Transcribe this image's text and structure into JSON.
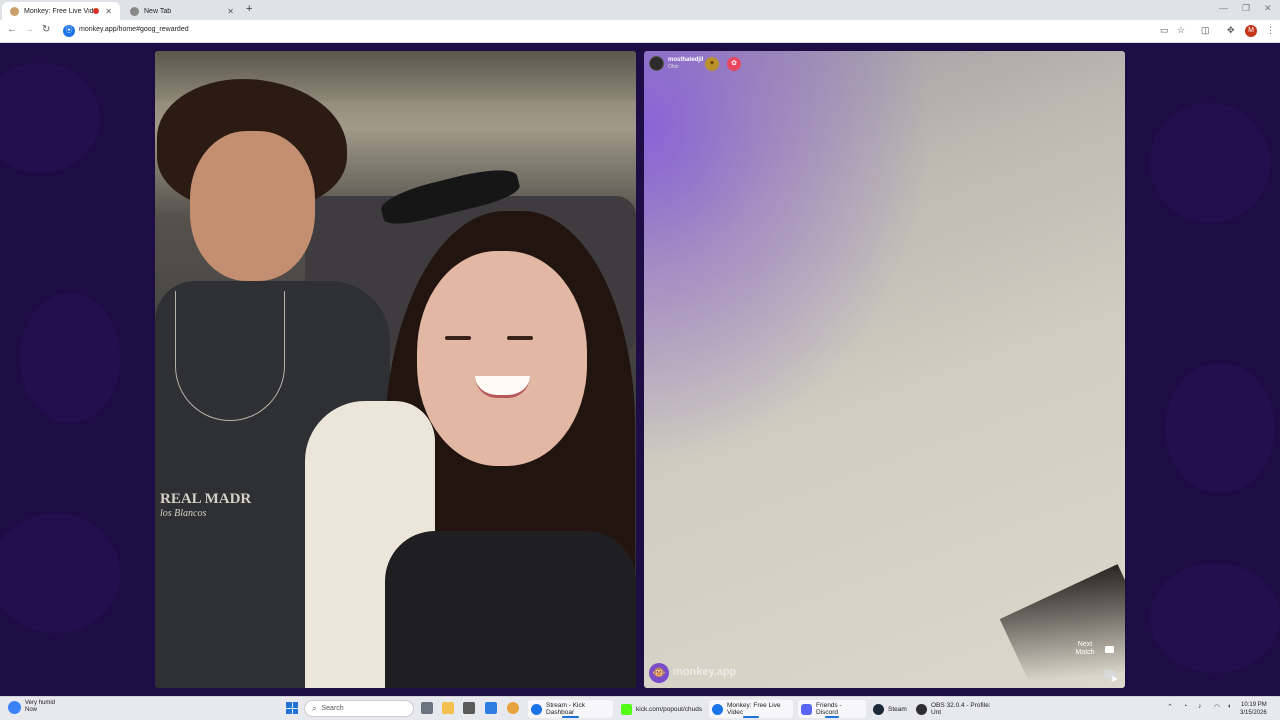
{
  "browser": {
    "tabs": [
      {
        "title": "Monkey: Free Live Video Ch",
        "active": true
      },
      {
        "title": "New Tab",
        "active": false
      }
    ],
    "url": "monkey.app/home#goog_rewarded",
    "profile_initial": "M"
  },
  "remote_user": {
    "name": "mosthatedjil",
    "status": "Ohio"
  },
  "left_video": {
    "shirt_text": "REAL MADR",
    "shirt_sub": "los Blancos"
  },
  "controls": {
    "next_match_label": "Next Match",
    "brand_text": "monkey.app"
  },
  "taskbar": {
    "weather_title": "Very humid",
    "weather_sub": "Now",
    "search_placeholder": "Search",
    "items": [
      {
        "label": "Stream - Kick Dashboar",
        "color": "#1a73e8"
      },
      {
        "label": "kick.com/popout/chuds",
        "color": "#53fc18"
      },
      {
        "label": "Monkey: Free Live Videc",
        "color": "#1a73e8"
      },
      {
        "label": "Friends - Discord",
        "color": "#5865f2"
      },
      {
        "label": "Steam",
        "color": "#1b2838"
      },
      {
        "label": "OBS 32.0.4 - Profile: Unt",
        "color": "#302e31"
      }
    ],
    "time": "10:19 PM",
    "date": "3/15/2026"
  },
  "colors": {
    "page_bg": "#1e0c45",
    "brand_purple": "#7a4cc9"
  }
}
